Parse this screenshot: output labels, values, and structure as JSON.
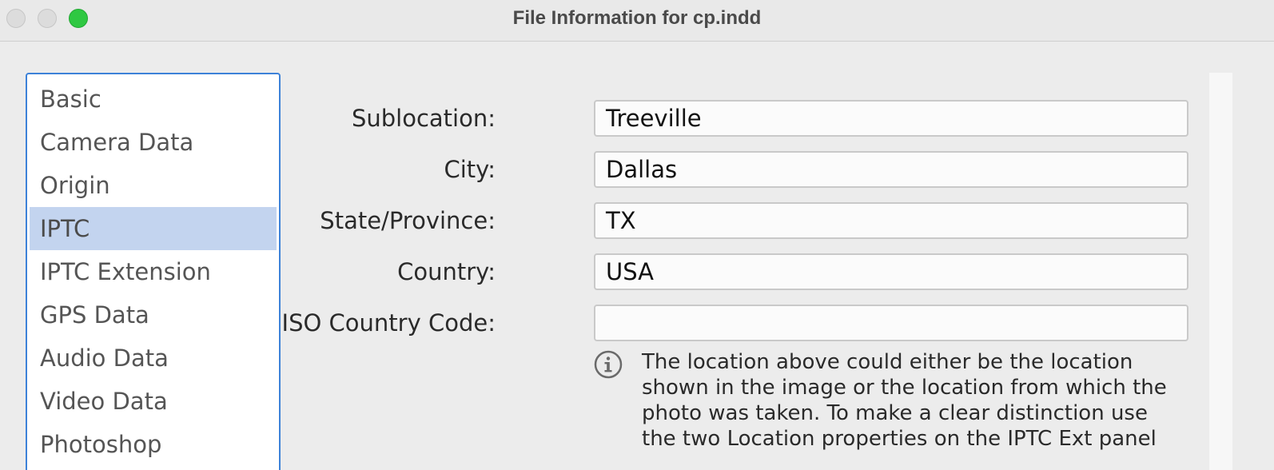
{
  "window": {
    "title": "File Information for cp.indd"
  },
  "sidebar": {
    "items": [
      {
        "label": "Basic",
        "selected": false
      },
      {
        "label": "Camera Data",
        "selected": false
      },
      {
        "label": "Origin",
        "selected": false
      },
      {
        "label": "IPTC",
        "selected": true
      },
      {
        "label": "IPTC Extension",
        "selected": false
      },
      {
        "label": "GPS Data",
        "selected": false
      },
      {
        "label": "Audio Data",
        "selected": false
      },
      {
        "label": "Video Data",
        "selected": false
      },
      {
        "label": "Photoshop",
        "selected": false
      }
    ]
  },
  "form": {
    "sublocation": {
      "label": "Sublocation:",
      "value": "Treeville"
    },
    "city": {
      "label": "City:",
      "value": "Dallas"
    },
    "state": {
      "label": "State/Province:",
      "value": "TX"
    },
    "country": {
      "label": "Country:",
      "value": "USA"
    },
    "iso_code": {
      "label": "ISO Country Code:",
      "value": ""
    }
  },
  "info": {
    "icon": "info-circle-icon",
    "line1": "The location above could either be the location",
    "line2": "shown in the image or the location from which the",
    "line3": "photo was taken. To make a clear distinction use",
    "line4": "the two Location properties on the IPTC Ext panel"
  },
  "colors": {
    "accent": "#3d82d8",
    "selection": "#c3d4ef",
    "maximize": "#2fc842"
  }
}
